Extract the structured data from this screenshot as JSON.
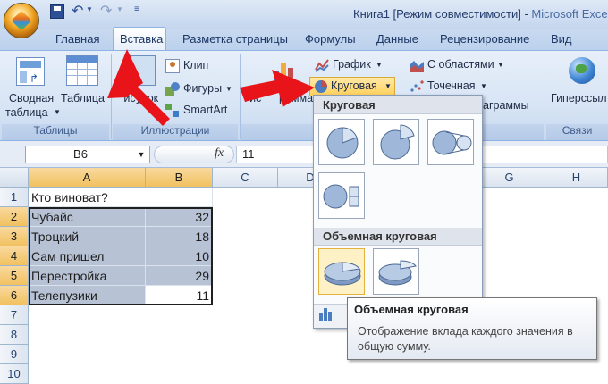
{
  "window": {
    "title": "Книга1  [Режим совместимости] - ",
    "app_name": "Microsoft Excel"
  },
  "tabs": [
    "Главная",
    "Вставка",
    "Разметка страницы",
    "Формулы",
    "Данные",
    "Рецензирование",
    "Вид"
  ],
  "active_tab": "Вставка",
  "ribbon": {
    "tables": {
      "label": "Таблицы",
      "pivot_line1": "Сводная",
      "pivot_line2": "таблица",
      "table": "Таблица"
    },
    "illustrations": {
      "label": "Иллюстрации",
      "picture_partial": "Рисунок",
      "clip": "Клип",
      "shapes": "Фигуры",
      "smartart": "SmartArt"
    },
    "charts": {
      "histogram_partial": "Гис",
      "histogram_partial2": "рамма",
      "graph": "График",
      "pie": "Круговая",
      "area": "С областями",
      "scatter": "Точечная",
      "other_partial": "аграммы"
    },
    "links": {
      "label": "Связи",
      "hyperlink_partial": "Гиперссыл"
    }
  },
  "formula_bar": {
    "name_box": "B6",
    "fx": "fx",
    "value": "11"
  },
  "columns": [
    "A",
    "B",
    "C",
    "D",
    "E",
    "F",
    "G",
    "H"
  ],
  "rows": [
    "1",
    "2",
    "3",
    "4",
    "5",
    "6",
    "7",
    "8",
    "9",
    "10"
  ],
  "cells": {
    "A1": "Кто виноват?",
    "A2": "Чубайс",
    "B2": "32",
    "A3": "Троцкий",
    "B3": "18",
    "A4": "Сам пришел",
    "B4": "10",
    "A5": "Перестройка",
    "B5": "29",
    "A6": "Телепузики",
    "B6": "11"
  },
  "pie_dropdown": {
    "section1": "Круговая",
    "section2": "Объемная круговая"
  },
  "tooltip": {
    "title": "Объемная круговая",
    "description": "Отображение вклада каждого значения в общую сумму."
  },
  "colors": {
    "accent_arrow": "#e8141a",
    "selection_fill": "#b7c2d5",
    "header_selected": "#f4cd7c"
  }
}
